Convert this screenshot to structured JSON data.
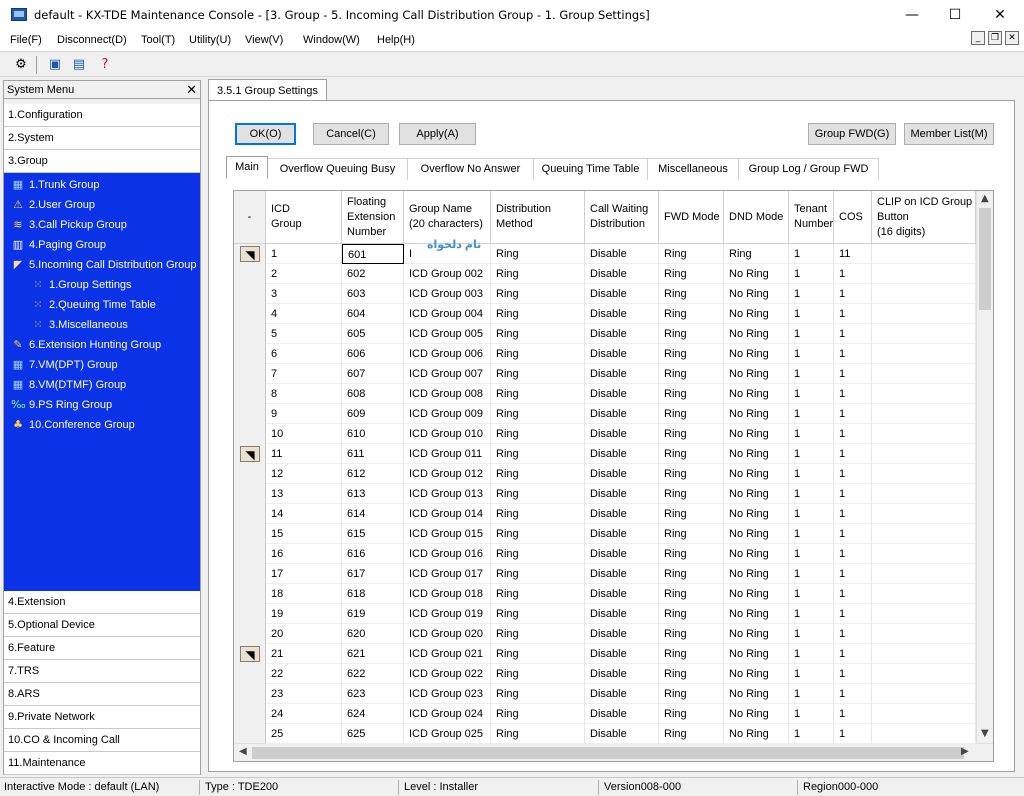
{
  "window": {
    "title": "default - KX-TDE Maintenance Console - [3. Group - 5. Incoming Call Distribution Group - 1. Group Settings]",
    "minimize": "—",
    "maximize": "☐",
    "close": "✕"
  },
  "menu": [
    "File(F)",
    "Disconnect(D)",
    "Tool(T)",
    "Utility(U)",
    "View(V)",
    "Window(W)",
    "Help(H)"
  ],
  "sidebar": {
    "header": "System Menu",
    "close": "✕",
    "top_categories": [
      "1.Configuration",
      "2.System",
      "3.Group"
    ],
    "tree": [
      {
        "label": "1.Trunk Group",
        "icon": "trunk-group-icon"
      },
      {
        "label": "2.User Group",
        "icon": "user-group-icon"
      },
      {
        "label": "3.Call Pickup Group",
        "icon": "call-pickup-icon"
      },
      {
        "label": "4.Paging Group",
        "icon": "paging-icon"
      },
      {
        "label": "5.Incoming Call Distribution Group",
        "icon": "icd-group-icon"
      },
      {
        "label": "1.Group Settings",
        "icon": "group-settings-icon"
      },
      {
        "label": "2.Queuing Time Table",
        "icon": "queuing-table-icon"
      },
      {
        "label": "3.Miscellaneous",
        "icon": "miscellaneous-icon"
      },
      {
        "label": "6.Extension Hunting Group",
        "icon": "hunting-group-icon"
      },
      {
        "label": "7.VM(DPT) Group",
        "icon": "vm-dpt-icon"
      },
      {
        "label": "8.VM(DTMF) Group",
        "icon": "vm-dtmf-icon"
      },
      {
        "label": "9.PS Ring Group",
        "icon": "ps-ring-icon"
      },
      {
        "label": "10.Conference Group",
        "icon": "conference-icon"
      }
    ],
    "bottom_categories": [
      "4.Extension",
      "5.Optional Device",
      "6.Feature",
      "7.TRS",
      "8.ARS",
      "9.Private Network",
      "10.CO & Incoming Call",
      "11.Maintenance"
    ]
  },
  "document_tab": "3.5.1 Group Settings",
  "buttons": {
    "ok": "OK(O)",
    "cancel": "Cancel(C)",
    "apply": "Apply(A)",
    "group_fwd": "Group FWD(G)",
    "member_list": "Member List(M)"
  },
  "subtabs": [
    "Main",
    "Overflow Queuing Busy",
    "Overflow No Answer",
    "Queuing Time Table",
    "Miscellaneous",
    "Group Log / Group FWD"
  ],
  "table": {
    "corner": "-",
    "headers": [
      "ICD\nGroup",
      "Floating\nExtension\nNumber",
      "Group Name\n(20 characters)",
      "Distribution\nMethod",
      "Call Waiting\nDistribution",
      "FWD Mode",
      "DND Mode",
      "Tenant\nNumber",
      "COS",
      "CLIP on ICD Group\nButton\n(16 digits)"
    ],
    "rows": [
      [
        "1",
        "601",
        "I",
        "Ring",
        "Disable",
        "Ring",
        "Ring",
        "1",
        "11",
        ""
      ],
      [
        "2",
        "602",
        "ICD Group 002",
        "Ring",
        "Disable",
        "Ring",
        "No Ring",
        "1",
        "1",
        ""
      ],
      [
        "3",
        "603",
        "ICD Group 003",
        "Ring",
        "Disable",
        "Ring",
        "No Ring",
        "1",
        "1",
        ""
      ],
      [
        "4",
        "604",
        "ICD Group 004",
        "Ring",
        "Disable",
        "Ring",
        "No Ring",
        "1",
        "1",
        ""
      ],
      [
        "5",
        "605",
        "ICD Group 005",
        "Ring",
        "Disable",
        "Ring",
        "No Ring",
        "1",
        "1",
        ""
      ],
      [
        "6",
        "606",
        "ICD Group 006",
        "Ring",
        "Disable",
        "Ring",
        "No Ring",
        "1",
        "1",
        ""
      ],
      [
        "7",
        "607",
        "ICD Group 007",
        "Ring",
        "Disable",
        "Ring",
        "No Ring",
        "1",
        "1",
        ""
      ],
      [
        "8",
        "608",
        "ICD Group 008",
        "Ring",
        "Disable",
        "Ring",
        "No Ring",
        "1",
        "1",
        ""
      ],
      [
        "9",
        "609",
        "ICD Group 009",
        "Ring",
        "Disable",
        "Ring",
        "No Ring",
        "1",
        "1",
        ""
      ],
      [
        "10",
        "610",
        "ICD Group 010",
        "Ring",
        "Disable",
        "Ring",
        "No Ring",
        "1",
        "1",
        ""
      ],
      [
        "11",
        "611",
        "ICD Group 011",
        "Ring",
        "Disable",
        "Ring",
        "No Ring",
        "1",
        "1",
        ""
      ],
      [
        "12",
        "612",
        "ICD Group 012",
        "Ring",
        "Disable",
        "Ring",
        "No Ring",
        "1",
        "1",
        ""
      ],
      [
        "13",
        "613",
        "ICD Group 013",
        "Ring",
        "Disable",
        "Ring",
        "No Ring",
        "1",
        "1",
        ""
      ],
      [
        "14",
        "614",
        "ICD Group 014",
        "Ring",
        "Disable",
        "Ring",
        "No Ring",
        "1",
        "1",
        ""
      ],
      [
        "15",
        "615",
        "ICD Group 015",
        "Ring",
        "Disable",
        "Ring",
        "No Ring",
        "1",
        "1",
        ""
      ],
      [
        "16",
        "616",
        "ICD Group 016",
        "Ring",
        "Disable",
        "Ring",
        "No Ring",
        "1",
        "1",
        ""
      ],
      [
        "17",
        "617",
        "ICD Group 017",
        "Ring",
        "Disable",
        "Ring",
        "No Ring",
        "1",
        "1",
        ""
      ],
      [
        "18",
        "618",
        "ICD Group 018",
        "Ring",
        "Disable",
        "Ring",
        "No Ring",
        "1",
        "1",
        ""
      ],
      [
        "19",
        "619",
        "ICD Group 019",
        "Ring",
        "Disable",
        "Ring",
        "No Ring",
        "1",
        "1",
        ""
      ],
      [
        "20",
        "620",
        "ICD Group 020",
        "Ring",
        "Disable",
        "Ring",
        "No Ring",
        "1",
        "1",
        ""
      ],
      [
        "21",
        "621",
        "ICD Group 021",
        "Ring",
        "Disable",
        "Ring",
        "No Ring",
        "1",
        "1",
        ""
      ],
      [
        "22",
        "622",
        "ICD Group 022",
        "Ring",
        "Disable",
        "Ring",
        "No Ring",
        "1",
        "1",
        ""
      ],
      [
        "23",
        "623",
        "ICD Group 023",
        "Ring",
        "Disable",
        "Ring",
        "No Ring",
        "1",
        "1",
        ""
      ],
      [
        "24",
        "624",
        "ICD Group 024",
        "Ring",
        "Disable",
        "Ring",
        "No Ring",
        "1",
        "1",
        ""
      ],
      [
        "25",
        "625",
        "ICD Group 025",
        "Ring",
        "Disable",
        "Ring",
        "No Ring",
        "1",
        "1",
        ""
      ]
    ],
    "marked_rows": [
      1,
      11,
      21
    ],
    "ime_watermark": "نام دلخواه"
  },
  "statusbar": {
    "mode": "Interactive Mode : default (LAN)",
    "type": "Type : TDE200",
    "level": "Level : Installer",
    "version": "Version008-000",
    "region": "Region000-000"
  },
  "colors": {
    "tree_background": "#0a32e6",
    "accent": "#0078d7"
  }
}
